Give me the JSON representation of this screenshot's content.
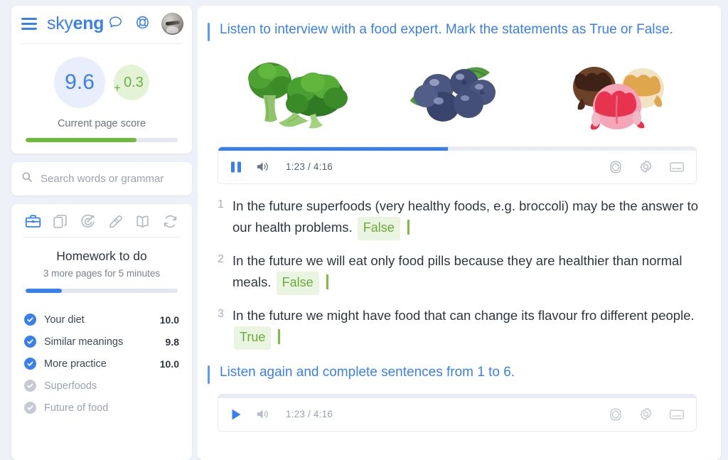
{
  "sidebar": {
    "brand": {
      "light": "sky",
      "bold": "eng"
    },
    "header_icons": [
      {
        "name": "menu-icon",
        "label": "Menu"
      },
      {
        "name": "chat-icon",
        "label": "Chat"
      },
      {
        "name": "lifebuoy-icon",
        "label": "Support"
      },
      {
        "name": "avatar",
        "label": "Profile"
      }
    ],
    "score": {
      "value": "9.6",
      "delta_prefix": "+",
      "delta": "0.3",
      "label": "Current page score",
      "progress_percent": 73,
      "progress_color": "#6fba3c",
      "circle_bg": "#e8eefb",
      "delta_bg": "#e4f2d6",
      "value_color": "#3a80ed",
      "delta_color": "#69b042"
    },
    "search": {
      "placeholder": "Search words or grammar",
      "value": "",
      "icon": "search-icon"
    },
    "tabs": [
      {
        "name": "tab-briefcase",
        "icon": "briefcase-icon",
        "active": true
      },
      {
        "name": "tab-cards",
        "icon": "cards-icon",
        "active": false
      },
      {
        "name": "tab-target",
        "icon": "target-icon",
        "active": false
      },
      {
        "name": "tab-pencil",
        "icon": "pencil-icon",
        "active": false
      },
      {
        "name": "tab-book",
        "icon": "open-book-icon",
        "active": false
      },
      {
        "name": "tab-refresh",
        "icon": "refresh-icon",
        "active": false
      }
    ],
    "homework": {
      "title": "Homework to do",
      "subtitle": "3 more pages for 5 minutes",
      "progress_percent": 24,
      "progress_color": "#3a80ed",
      "items": [
        {
          "label": "Your diet",
          "score": "10.0",
          "done": true
        },
        {
          "label": "Similar meanings",
          "score": "9.8",
          "done": true
        },
        {
          "label": "More practice",
          "score": "10.0",
          "done": true
        },
        {
          "label": "Superfoods",
          "score": "",
          "done": false
        },
        {
          "label": "Future of food",
          "score": "",
          "done": false
        }
      ]
    }
  },
  "main": {
    "task1": {
      "heading": "Listen to interview with a food expert. Mark the statements as True or False.",
      "images": [
        {
          "name": "broccoli-image",
          "alt": "broccoli"
        },
        {
          "name": "blueberries-image",
          "alt": "blueberries"
        },
        {
          "name": "ice-cream-image",
          "alt": "ice cream scoops"
        }
      ],
      "player": {
        "state": "playing",
        "play_icon": "pause-icon",
        "volume_icon": "volume-icon",
        "time": "1:23 / 4:16",
        "current": "1:23",
        "duration": "4:16",
        "progress_percent": 48,
        "right_icons": [
          {
            "name": "miniplayer-icon"
          },
          {
            "name": "gear-icon"
          },
          {
            "name": "subtitles-icon"
          }
        ]
      },
      "statements": [
        {
          "num": "1",
          "before": "In the future superfoods (very healthy foods, e.g. broccoli) may be the answer to our health problems.",
          "answer": "False",
          "after": ""
        },
        {
          "num": "2",
          "before": "In the future we will eat only food pills because they are healthier than normal meals.",
          "answer": "False",
          "after": ""
        },
        {
          "num": "3",
          "before": "In the future we might have food that can change its flavour fro different people.",
          "answer": "True",
          "after": ""
        }
      ]
    },
    "task2": {
      "heading": "Listen again and complete sentences from 1 to 6.",
      "player": {
        "state": "paused",
        "play_icon": "play-icon",
        "volume_icon": "volume-icon",
        "time": "1:23 / 4:16",
        "current": "1:23",
        "duration": "4:16",
        "progress_percent": 0,
        "right_icons": [
          {
            "name": "miniplayer-icon"
          },
          {
            "name": "gear-icon"
          },
          {
            "name": "subtitles-icon"
          }
        ]
      }
    }
  },
  "colors": {
    "accent_blue": "#3a80ed",
    "heading_blue": "#3a80ed",
    "green": "#6aa83c",
    "answer_bg": "#eaf5e1",
    "page_bg": "#eef1f7"
  }
}
